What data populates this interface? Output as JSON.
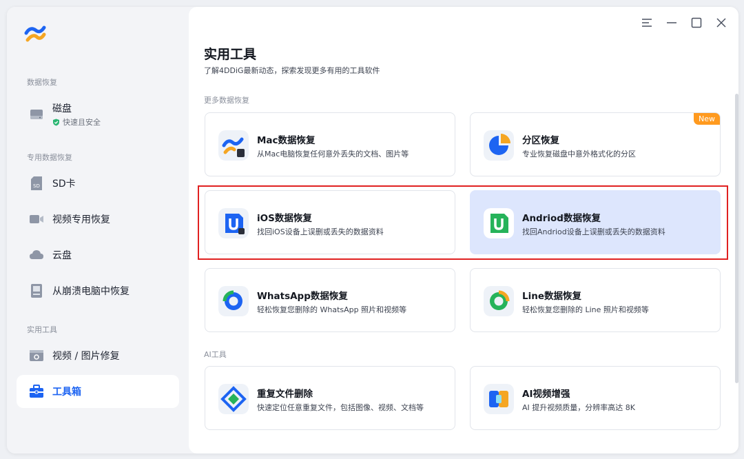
{
  "sidebar": {
    "sections": {
      "data_recovery": "数据恢复",
      "special_recovery": "专用数据恢复",
      "tools": "实用工具"
    },
    "items": [
      {
        "label": "磁盘",
        "note": "快速且安全",
        "icon": "disk-icon"
      },
      {
        "label": "SD卡",
        "icon": "sd-card-icon"
      },
      {
        "label": "视频专用恢复",
        "icon": "video-camera-icon"
      },
      {
        "label": "云盘",
        "icon": "cloud-icon"
      },
      {
        "label": "从崩溃电脑中恢复",
        "icon": "crashed-pc-icon"
      },
      {
        "label": "视频 / 图片修复",
        "icon": "media-repair-icon"
      },
      {
        "label": "工具箱",
        "icon": "toolbox-icon",
        "active": true
      }
    ]
  },
  "window_controls": [
    "menu-icon",
    "minimize-icon",
    "maximize-icon",
    "close-icon"
  ],
  "main": {
    "title": "实用工具",
    "subtitle": "了解4DDiG最新动态，探索发现更多有用的工具软件",
    "group_more": "更多数据恢复",
    "group_ai": "AI工具",
    "cards": [
      {
        "title": "Mac数据恢复",
        "desc": "从Mac电脑恢复任何意外丢失的文档、图片等",
        "icon": "mac-recovery-icon"
      },
      {
        "title": "分区恢复",
        "desc": "专业恢复磁盘中意外格式化的分区",
        "icon": "partition-recovery-icon",
        "badge": "New"
      },
      {
        "title": "iOS数据恢复",
        "desc": "找回iOS设备上误删或丢失的数据资料",
        "icon": "ios-recovery-icon"
      },
      {
        "title": "Andriod数据恢复",
        "desc": "找回Andriod设备上误删或丢失的数据资料",
        "icon": "android-recovery-icon"
      },
      {
        "title": "WhatsApp数据恢复",
        "desc": "轻松恢复您删除的 WhatsApp 照片和视频等",
        "icon": "whatsapp-recovery-icon"
      },
      {
        "title": "Line数据恢复",
        "desc": "轻松恢复您删除的 Line 照片和视频等",
        "icon": "line-recovery-icon"
      },
      {
        "title": "重复文件删除",
        "desc": "快速定位任意重复文件，包括图像、视频、文档等",
        "icon": "duplicate-file-icon"
      },
      {
        "title": "AI视频增强",
        "desc": "AI 提升视频质量，分辨率高达 8K",
        "icon": "ai-video-icon"
      }
    ]
  },
  "colors": {
    "accent": "#1d64f2",
    "highlight": "#dde6fd",
    "badge": "#ff9a1f",
    "annotation": "#e02020"
  }
}
